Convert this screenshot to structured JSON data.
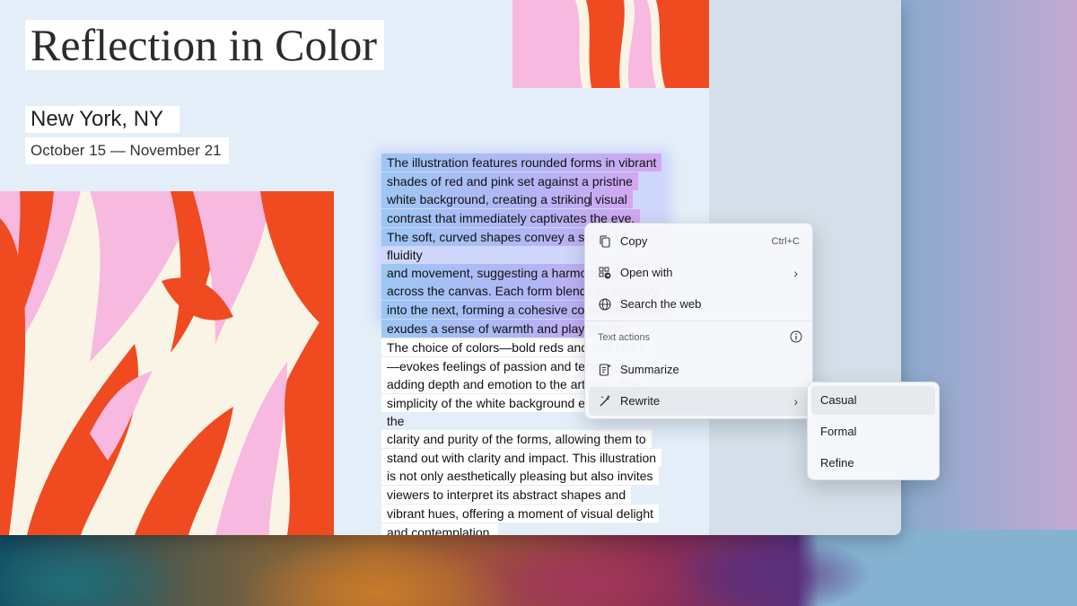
{
  "document": {
    "title": "Reflection in Color",
    "location": "New York, NY",
    "dates": "October 15 — November 21",
    "paragraph1_lines": [
      "The illustration features rounded forms in vibrant",
      "shades of red and pink set against a pristine",
      "white background, creating a striking",
      "visual",
      "contrast that immediately captivates the eye.",
      "The soft, curved shapes convey a sense of fluidity",
      "and movement, suggesting a harmonious flow",
      "across the canvas. Each form blends seamlessly",
      "into the next, forming a cohesive composition that",
      "exudes a sense of warmth and playfulness."
    ],
    "paragraph2_lines": [
      "The choice of colors—bold reds and soft pinks",
      "—evokes feelings of passion and tenderness,",
      "adding depth and emotion to the artwork. The",
      "simplicity of the white background emphasizes the",
      "clarity and purity of the forms, allowing them to",
      "stand out with clarity and impact. This illustration",
      "is not only aesthetically pleasing but also invites",
      "viewers to interpret its abstract shapes and",
      "vibrant hues, offering a moment of visual delight",
      "and contemplation."
    ]
  },
  "context_menu": {
    "copy": {
      "label": "Copy",
      "shortcut": "Ctrl+C",
      "icon": "copy-icon"
    },
    "open_with": {
      "label": "Open with",
      "icon": "open-with-icon"
    },
    "search_web": {
      "label": "Search the web",
      "icon": "globe-icon"
    },
    "section_header": "Text actions",
    "summarize": {
      "label": "Summarize",
      "icon": "summarize-icon"
    },
    "rewrite": {
      "label": "Rewrite",
      "icon": "rewrite-icon"
    }
  },
  "rewrite_submenu": {
    "items": [
      "Casual",
      "Formal",
      "Refine"
    ]
  },
  "colors": {
    "art_red": "#f04a20",
    "art_pink": "#f7b9df",
    "art_cream": "#faf4e6",
    "selection_start": "#9cc7f4",
    "selection_end": "#d2a7f1"
  }
}
